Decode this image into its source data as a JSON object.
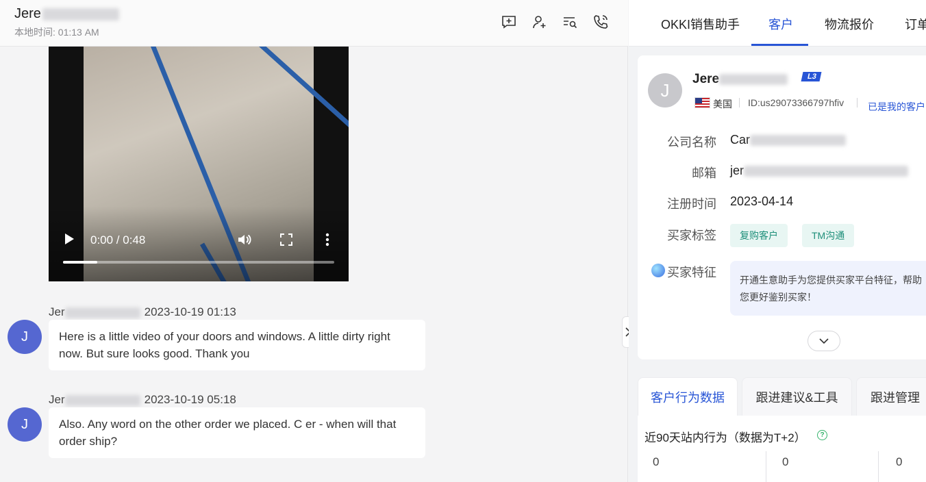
{
  "chat": {
    "contact_name": "Jere",
    "local_time": "本地时间: 01:13 AM",
    "header_icons": [
      "new-message-icon",
      "add-contact-icon",
      "search-history-icon",
      "phone-call-icon"
    ],
    "video": {
      "time_display": "0:00 / 0:48",
      "progress": 0.125
    },
    "messages": [
      {
        "sender": "Jer",
        "timestamp": "2023-10-19 01:13",
        "avatar_letter": "J",
        "text": "Here is a little video of your doors and windows. A little dirty right now. But sure looks good. Thank you"
      },
      {
        "sender": "Jer",
        "timestamp": "2023-10-19 05:18",
        "avatar_letter": "J",
        "text": "Also. Any word on the other order we placed. C      er - when will that order ship?"
      }
    ]
  },
  "side": {
    "tabs": [
      "OKKI销售助手",
      "客户",
      "物流报价",
      "订单"
    ],
    "active_tab": "客户",
    "customer": {
      "avatar_letter": "J",
      "name": "Jere",
      "level": "L3",
      "country": "美国",
      "id": "ID:us29073366797hfiv",
      "my_customer": "已是我的客户",
      "fields": [
        {
          "label": "公司名称",
          "value": "Car"
        },
        {
          "label": "邮箱",
          "value": "jer"
        },
        {
          "label": "注册时间",
          "value": "2023-04-14"
        },
        {
          "label": "买家标签",
          "value": ""
        }
      ],
      "tags": [
        "复购客户",
        "TM沟通"
      ],
      "feature_label": "买家特征",
      "feature_text": "开通生意助手为您提供买家平台特征，帮助您更好鉴别买家！"
    },
    "sub_tabs": [
      "客户行为数据",
      "跟进建议&工具",
      "跟进管理"
    ],
    "active_sub_tab": "客户行为数据",
    "behavior": {
      "title": "近90天站内行为（数据为T+2）",
      "stats": [
        "0",
        "0",
        "0"
      ]
    },
    "colors": {
      "accent": "#2855d6",
      "avatar": "#5567d1",
      "tag_text": "#1e8f7a"
    }
  }
}
